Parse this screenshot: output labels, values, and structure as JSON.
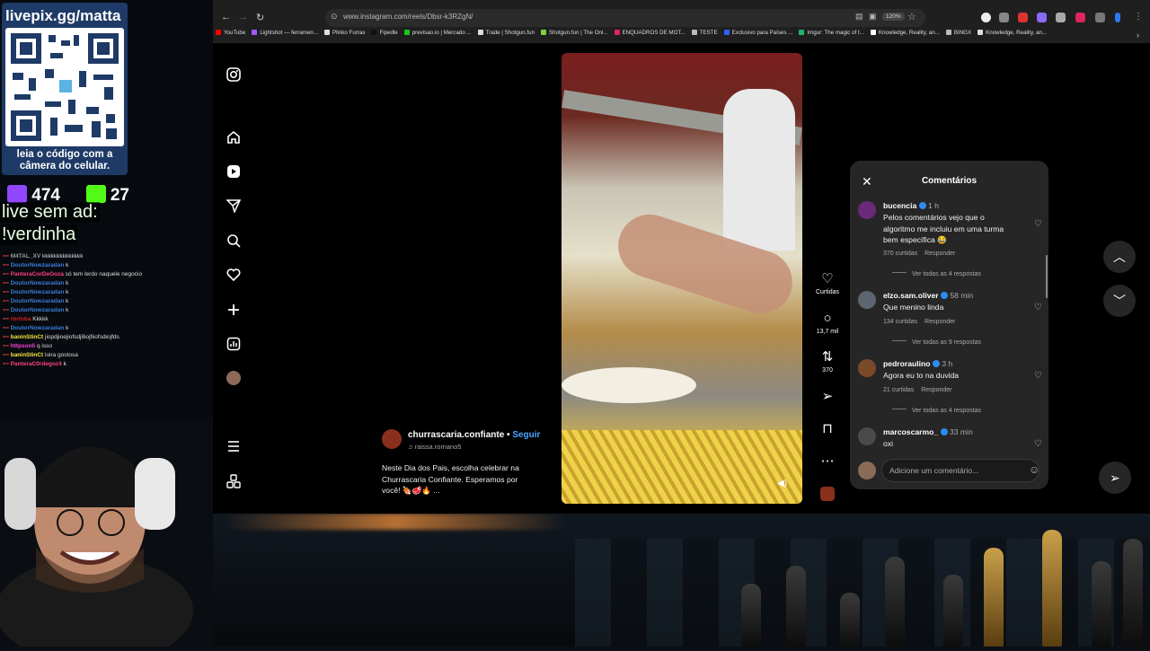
{
  "stream_overlay": {
    "qr_title": "livepix.gg/matta",
    "qr_caption": "leia o código com a câmera do celular.",
    "viewers_count": "474",
    "kick_count": "27",
    "line1": "live sem ad:",
    "line2": "!verdinha",
    "chat": [
      {
        "user": "M4TAL_XV",
        "text": "kkkkkkkkkkkkkk",
        "color": "#9a9a9a"
      },
      {
        "user": "DoutorNowzaradan",
        "text": "k",
        "color": "#3a7bd5"
      },
      {
        "user": "PanteraCorDeGoza",
        "text": "só tem lerdo naquele negocio",
        "color": "#ff3f7f"
      },
      {
        "user": "DoutorNowzaradan",
        "text": "k",
        "color": "#3a7bd5"
      },
      {
        "user": "DoutorNowzaradan",
        "text": "k",
        "color": "#3a7bd5"
      },
      {
        "user": "DoutorNowzaradan",
        "text": "k",
        "color": "#3a7bd5"
      },
      {
        "user": "DoutorNowzaradan",
        "text": "k",
        "color": "#3a7bd5"
      },
      {
        "user": "rbrtoba",
        "text": "Kkkkk",
        "color": "#d02020"
      },
      {
        "user": "DoutorNowzaradan",
        "text": "k",
        "color": "#3a7bd5"
      },
      {
        "user": "baninStinCt",
        "text": "jiopdjioejiofsdj8iojfiiofsdiojfds",
        "color": "#f5e642"
      },
      {
        "user": "httpsonli",
        "text": "q isso",
        "color": "#ff3fcf"
      },
      {
        "user": "baninStinCt",
        "text": "loira gostosa",
        "color": "#f5e642"
      },
      {
        "user": "PanteraC0rdegoz4",
        "text": "k",
        "color": "#ff3f7f"
      }
    ]
  },
  "browser": {
    "url": "www.instagram.com/reels/Dbsr-k3RZgN/",
    "zoom": "120%",
    "bookmarks": [
      {
        "label": "YouTube",
        "color": "#ff0000"
      },
      {
        "label": "Lightshot — ferramen...",
        "color": "#a259ff"
      },
      {
        "label": "Plinko Furras",
        "color": "#dddddd"
      },
      {
        "label": "Fipedle",
        "color": "#111111"
      },
      {
        "label": "previsao.io | Mercado ...",
        "color": "#1ec11e"
      },
      {
        "label": "Trade | Shotgun.fun",
        "color": "#dddddd"
      },
      {
        "label": "Shotgun.fun | The Onl...",
        "color": "#7fd13b"
      },
      {
        "label": "ENQUADROS DE MOT...",
        "color": "#e0245e"
      },
      {
        "label": "TESTE",
        "color": "#bbbbbb"
      },
      {
        "label": "Exclusivo para Países ...",
        "color": "#3060ff"
      },
      {
        "label": "Imgur: The magic of t...",
        "color": "#1bb76e"
      },
      {
        "label": "Knowledge, Reality, an...",
        "color": "#ffffff"
      },
      {
        "label": "BINGX",
        "color": "#bbbbbb"
      },
      {
        "label": "Knowledge, Reality, an...",
        "color": "#dddddd"
      }
    ]
  },
  "reel": {
    "account": "churrascaria.confiante",
    "follow_label": "Seguir",
    "audio": "raissa.romano5",
    "caption": "Neste Dia dos Pais, escolha celebrar na Churrascaria Confiante. Esperamos por você! 🍖🥩🔥 ...",
    "likes_label": "Curtidas",
    "comments_count": "13,7 mil",
    "reposts_count": "370"
  },
  "comments_panel": {
    "title": "Comentários",
    "input_placeholder": "Adicione um comentário...",
    "reply_label": "Responder",
    "comments": [
      {
        "user": "bucencia",
        "time": "1 h",
        "text": "Pelos comentários vejo que o algoritmo me incluiu em uma turma bem específica 😂",
        "likes": "370 curtidas",
        "more": "Ver todas as 4 respostas",
        "avatar_color": "#6a2a7a"
      },
      {
        "user": "elzo.sam.oliver",
        "time": "58 min",
        "text": "Que menino linda",
        "likes": "134 curtidas",
        "more": "Ver todas as 9 respostas",
        "avatar_color": "#5d6670"
      },
      {
        "user": "pedroraulino",
        "time": "3 h",
        "text": "Agora eu to na duvida",
        "likes": "21 curtidas",
        "more": "Ver todas as 4 respostas",
        "avatar_color": "#7a4a2a"
      },
      {
        "user": "marcoscarmo_",
        "time": "33 min",
        "text": "oxi",
        "likes": "",
        "more": "",
        "avatar_color": "#4a4a4a"
      }
    ]
  }
}
